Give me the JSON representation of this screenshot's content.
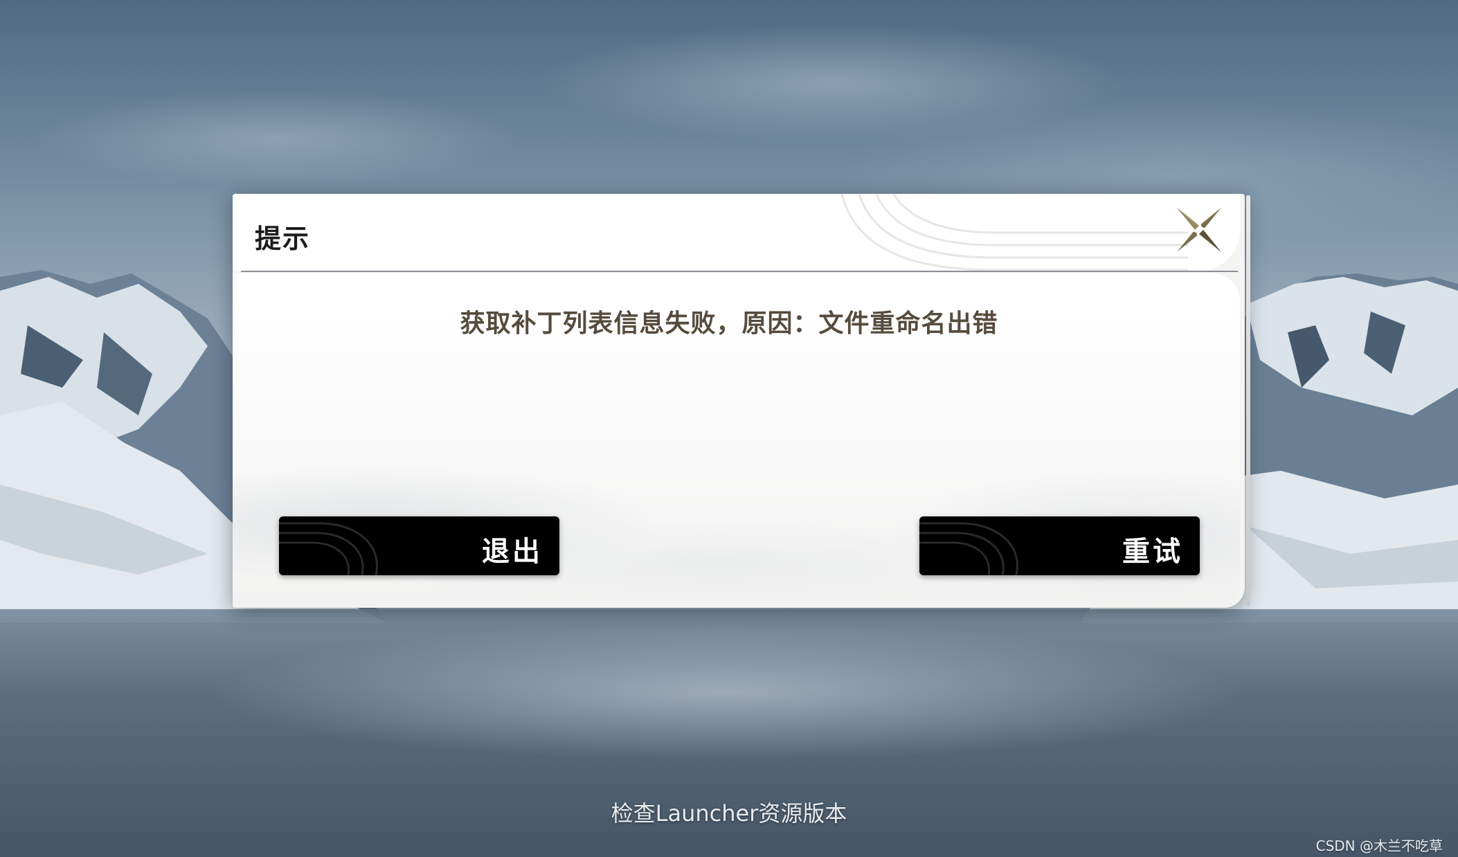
{
  "dialog": {
    "title": "提示",
    "message": "获取补丁列表信息失败，原因：文件重命名出错",
    "buttons": {
      "exit_label": "退出",
      "retry_label": "重试"
    },
    "close_icon": "close-icon"
  },
  "status": {
    "text": "检查Launcher资源版本"
  },
  "watermark": {
    "text": "CSDN @木兰不吃草"
  },
  "colors": {
    "dialog_bg": "#f4f4f3",
    "message_text": "#564b3c",
    "button_bg": "#000000",
    "close_icon_gold": "#8a7a55"
  }
}
